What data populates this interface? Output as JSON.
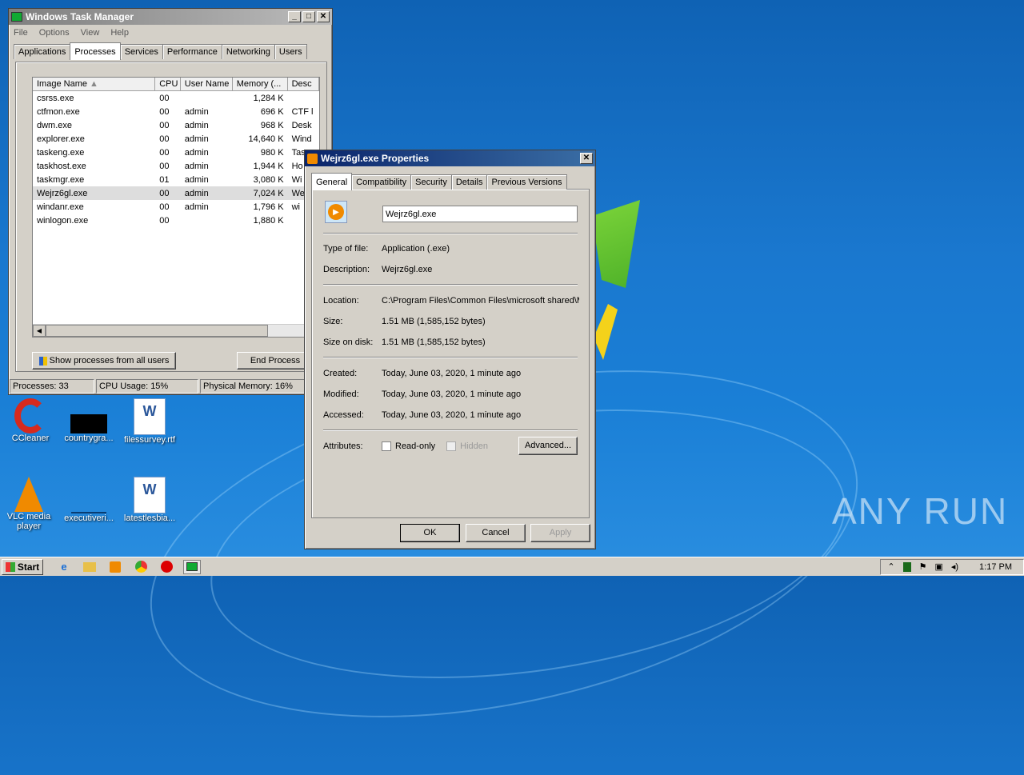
{
  "taskmgr": {
    "title": "Windows Task Manager",
    "menu": [
      "File",
      "Options",
      "View",
      "Help"
    ],
    "tabs": [
      "Applications",
      "Processes",
      "Services",
      "Performance",
      "Networking",
      "Users"
    ],
    "columns": [
      "Image Name",
      "CPU",
      "User Name",
      "Memory (...",
      "Desc"
    ],
    "rows": [
      {
        "name": "csrss.exe",
        "cpu": "00",
        "user": "",
        "mem": "1,284 K",
        "desc": ""
      },
      {
        "name": "ctfmon.exe",
        "cpu": "00",
        "user": "admin",
        "mem": "696 K",
        "desc": "CTF l"
      },
      {
        "name": "dwm.exe",
        "cpu": "00",
        "user": "admin",
        "mem": "968 K",
        "desc": "Desk"
      },
      {
        "name": "explorer.exe",
        "cpu": "00",
        "user": "admin",
        "mem": "14,640 K",
        "desc": "Wind"
      },
      {
        "name": "taskeng.exe",
        "cpu": "00",
        "user": "admin",
        "mem": "980 K",
        "desc": "Tas"
      },
      {
        "name": "taskhost.exe",
        "cpu": "00",
        "user": "admin",
        "mem": "1,944 K",
        "desc": "Ho"
      },
      {
        "name": "taskmgr.exe",
        "cpu": "01",
        "user": "admin",
        "mem": "3,080 K",
        "desc": "Wi"
      },
      {
        "name": "Wejrz6gl.exe",
        "cpu": "00",
        "user": "admin",
        "mem": "7,024 K",
        "desc": "We"
      },
      {
        "name": "windanr.exe",
        "cpu": "00",
        "user": "admin",
        "mem": "1,796 K",
        "desc": "wi"
      },
      {
        "name": "winlogon.exe",
        "cpu": "00",
        "user": "",
        "mem": "1,880 K",
        "desc": ""
      }
    ],
    "show_all_label": "Show processes from all users",
    "end_process_label": "End Process",
    "status_processes": "Processes: 33",
    "status_cpu": "CPU Usage: 15%",
    "status_mem": "Physical Memory: 16%"
  },
  "props": {
    "title": "Wejrz6gl.exe Properties",
    "tabs": [
      "General",
      "Compatibility",
      "Security",
      "Details",
      "Previous Versions"
    ],
    "filename": "Wejrz6gl.exe",
    "type_label": "Type of file:",
    "type_value": "Application (.exe)",
    "desc_label": "Description:",
    "desc_value": "Wejrz6gl.exe",
    "loc_label": "Location:",
    "loc_value": "C:\\Program Files\\Common Files\\microsoft shared\\MS",
    "size_label": "Size:",
    "size_value": "1.51 MB (1,585,152 bytes)",
    "disk_label": "Size on disk:",
    "disk_value": "1.51 MB (1,585,152 bytes)",
    "created_label": "Created:",
    "created_value": "Today, June 03, 2020, 1 minute ago",
    "modified_label": "Modified:",
    "modified_value": "Today, June 03, 2020, 1 minute ago",
    "accessed_label": "Accessed:",
    "accessed_value": "Today, June 03, 2020, 1 minute ago",
    "attr_label": "Attributes:",
    "readonly_label": "Read-only",
    "hidden_label": "Hidden",
    "advanced_label": "Advanced...",
    "ok_label": "OK",
    "cancel_label": "Cancel",
    "apply_label": "Apply"
  },
  "desktop": {
    "icons": [
      "CCleaner",
      "countrygra...",
      "filessurvey.rtf",
      "VLC media player",
      "executiveri...",
      "latestlesbia..."
    ],
    "watermark": "ANY RUN"
  },
  "taskbar": {
    "start_label": "Start",
    "clock": "1:17 PM"
  }
}
